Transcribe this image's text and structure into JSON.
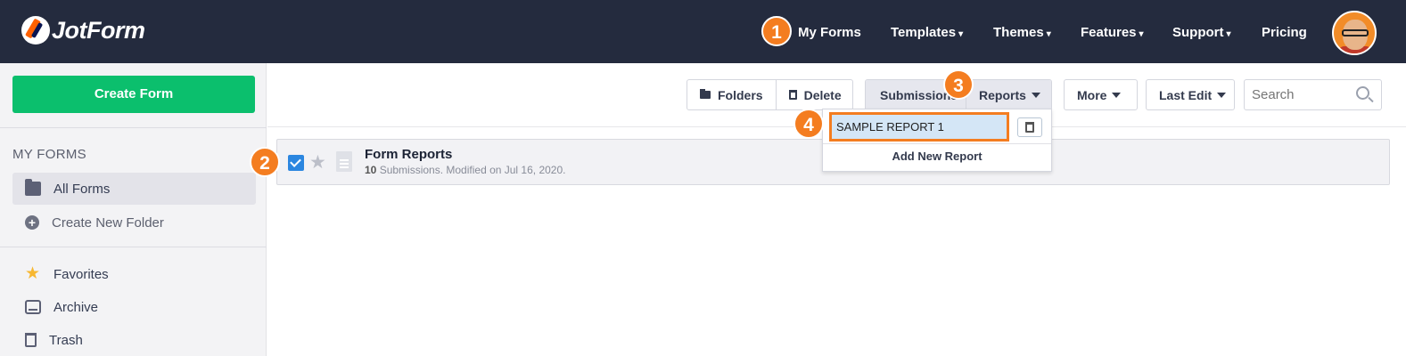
{
  "app": {
    "logo_text": "JotForm"
  },
  "nav": {
    "items": [
      {
        "label": "My Forms",
        "caret": ""
      },
      {
        "label": "Templates",
        "caret": "▾"
      },
      {
        "label": "Themes",
        "caret": "▾"
      },
      {
        "label": "Features",
        "caret": "▾"
      },
      {
        "label": "Support",
        "caret": "▾"
      },
      {
        "label": "Pricing",
        "caret": ""
      }
    ]
  },
  "badges": [
    "1",
    "2",
    "3",
    "4"
  ],
  "sidebar": {
    "create_label": "Create Form",
    "heading": "MY FORMS",
    "items": [
      {
        "label": "All Forms",
        "icon": "folder-icon"
      },
      {
        "label": "Create New Folder",
        "icon": "plus-circle-icon"
      },
      {
        "label": "Favorites",
        "icon": "star-icon"
      },
      {
        "label": "Archive",
        "icon": "archive-icon"
      },
      {
        "label": "Trash",
        "icon": "trash-icon"
      }
    ]
  },
  "toolbar": {
    "folders_label": "Folders",
    "delete_label": "Delete",
    "submissions_label": "Submissions",
    "reports_label": "Reports",
    "more_label": "More",
    "sort_label": "Last Edit",
    "search_placeholder": "Search"
  },
  "form": {
    "title": "Form Reports",
    "submission_count": "10",
    "meta": " Submissions. Modified on Jul 16, 2020.",
    "checked": true
  },
  "reports_menu": {
    "report_name": "SAMPLE REPORT 1",
    "add_label": "Add New Report"
  },
  "colors": {
    "navbar": "#242b3e",
    "create_button": "#0bbf6d",
    "badge": "#f47d20",
    "highlight": "#d4e6f6"
  }
}
